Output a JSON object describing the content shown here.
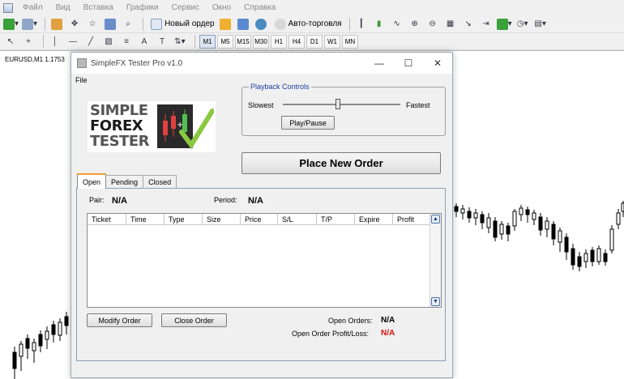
{
  "host": {
    "menu": [
      "Файл",
      "Вид",
      "Вставка",
      "Графики",
      "Сервис",
      "Окно",
      "Справка"
    ],
    "toolbar": {
      "new_order_label": "Новый ордер",
      "autotrade_label": "Авто-торговля"
    },
    "timeframes": [
      "M1",
      "M5",
      "M15",
      "M30",
      "H1",
      "H4",
      "D1",
      "W1",
      "MN"
    ],
    "chart_label": "EURUSD,M1  1.1753"
  },
  "dialog": {
    "title": "SimpleFX Tester Pro v1.0",
    "file_menu": "File",
    "logo": {
      "line1": "SIMPLE",
      "line2": "FOREX",
      "line3": "TESTER"
    },
    "playback": {
      "legend": "Playback Controls",
      "slowest": "Slowest",
      "fastest": "Fastest",
      "speed_fraction": 0.47,
      "play_pause_label": "Play/Pause"
    },
    "place_order_label": "Place New Order",
    "tabs": [
      "Open",
      "Pending",
      "Closed"
    ],
    "active_tab": "Open",
    "pair_label": "Pair:",
    "pair_value": "N/A",
    "period_label": "Period:",
    "period_value": "N/A",
    "columns": [
      "Ticket",
      "Time",
      "Type",
      "Size",
      "Price",
      "S/L",
      "T/P",
      "Expire",
      "Profit"
    ],
    "modify_label": "Modify Order",
    "close_label": "Close Order",
    "open_orders_label": "Open Orders:",
    "open_orders_value": "N/A",
    "profit_label": "Open Order Profit/Loss:",
    "profit_value": "N/A",
    "profit_color": "#d01010"
  }
}
